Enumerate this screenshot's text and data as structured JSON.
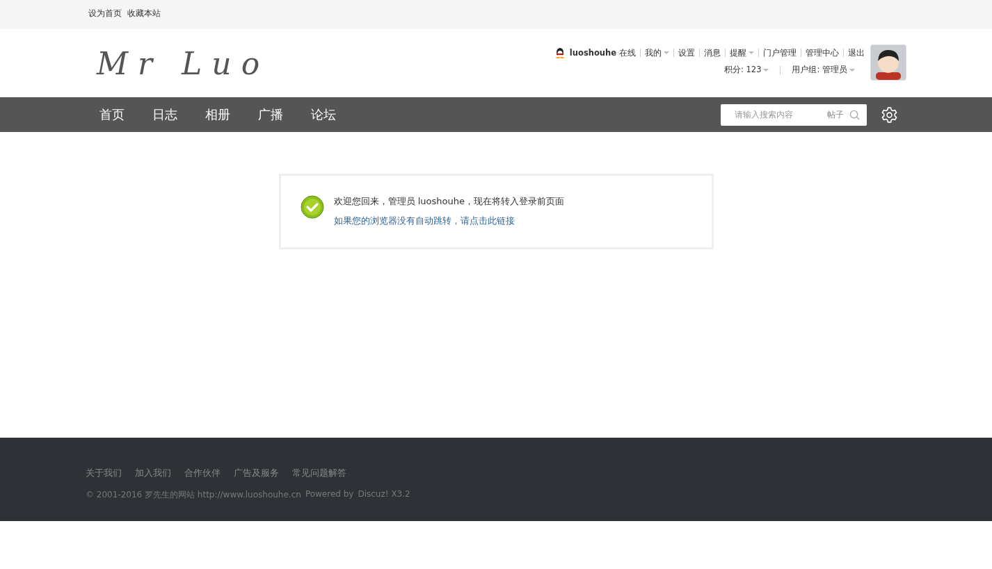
{
  "topbar": {
    "links": [
      "设为首页",
      "收藏本站"
    ]
  },
  "header": {
    "logo": "Mr Luo",
    "username": "luoshouhe",
    "status": "在线",
    "user_links": [
      {
        "label": "我的",
        "dropdown": true
      },
      {
        "label": "设置",
        "dropdown": false
      },
      {
        "label": "消息",
        "dropdown": false
      },
      {
        "label": "提醒",
        "dropdown": true
      },
      {
        "label": "门户管理",
        "dropdown": false
      },
      {
        "label": "管理中心",
        "dropdown": false
      },
      {
        "label": "退出",
        "dropdown": false
      }
    ],
    "credits": {
      "label": "积分: 123",
      "dropdown": true
    },
    "group": {
      "label": "用户组: 管理员",
      "dropdown": true
    }
  },
  "nav": {
    "items": [
      "首页",
      "日志",
      "相册",
      "广播",
      "论坛"
    ],
    "search": {
      "placeholder": "请输入搜索内容",
      "scope": "帖子"
    }
  },
  "message": {
    "text": "欢迎您回来，管理员 luoshouhe，现在将转入登录前页面",
    "link": "如果您的浏览器没有自动跳转，请点击此链接"
  },
  "footer": {
    "links": [
      "关于我们",
      "加入我们",
      "合作伙伴",
      "广告及服务",
      "常见问题解答"
    ],
    "copyright": "© 2001-2016 罗先生的网站 http://www.luoshouhe.cn",
    "powered": "Powered by",
    "product": "Discuz! X3.2"
  }
}
